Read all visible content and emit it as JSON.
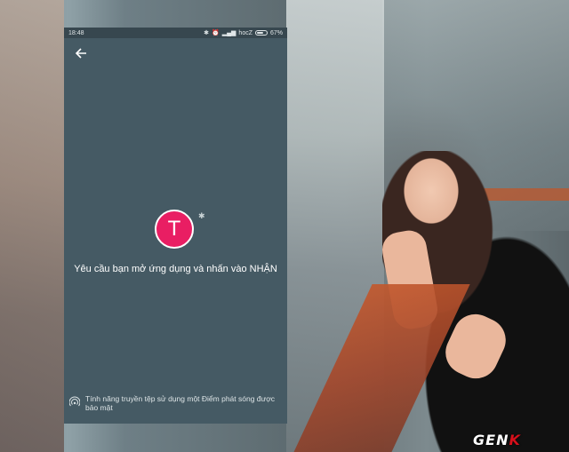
{
  "status_bar": {
    "time": "18:48",
    "network": "hocZ",
    "battery": "67%"
  },
  "app": {
    "avatar_letter": "T",
    "message": "Yêu cầu bạn mở ứng dụng và nhấn vào NHẬN",
    "footer_note": "Tính năng truyền tệp sử dụng một Điểm phát sóng được bảo mật"
  },
  "watermark": {
    "text_main": "GEN",
    "text_accent": "K"
  },
  "colors": {
    "avatar_bg": "#e91e63",
    "screen_bg": "#455a64"
  }
}
